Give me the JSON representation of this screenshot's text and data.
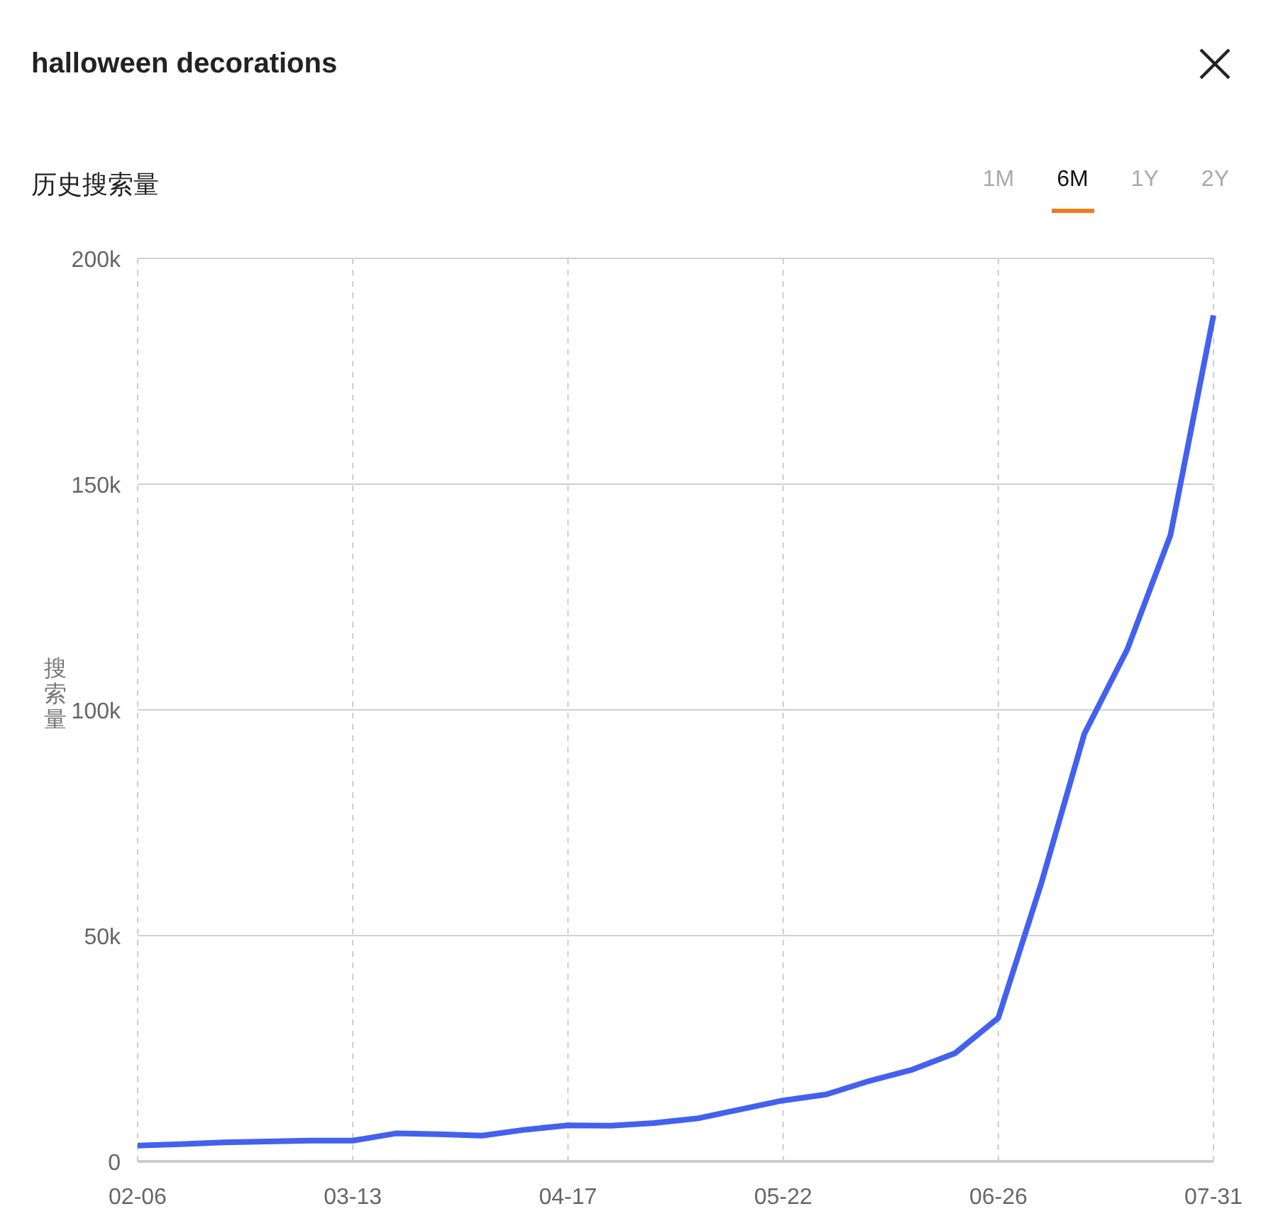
{
  "title": "halloween decorations",
  "section_title": "历史搜索量",
  "tabs": [
    {
      "label": "1M",
      "selected": false
    },
    {
      "label": "6M",
      "selected": true
    },
    {
      "label": "1Y",
      "selected": false
    },
    {
      "label": "2Y",
      "selected": false
    }
  ],
  "chart_data": {
    "type": "line",
    "ylabel": "搜索量",
    "categories": [
      "02-06",
      null,
      null,
      null,
      null,
      "03-13",
      null,
      null,
      null,
      null,
      "04-17",
      null,
      null,
      null,
      null,
      "05-22",
      null,
      null,
      null,
      null,
      "06-26",
      null,
      null,
      null,
      null,
      "07-31"
    ],
    "series": [
      {
        "color": "#4361ee",
        "values": [
          3500,
          3800,
          4200,
          4400,
          4600,
          4600,
          6200,
          6000,
          5700,
          7000,
          8000,
          7900,
          8500,
          9500,
          11500,
          13500,
          14800,
          17800,
          20300,
          24000,
          31800,
          61600,
          94700,
          113500,
          138700,
          187400
        ]
      }
    ],
    "ylim": [
      0,
      200000
    ],
    "grid": true,
    "yticks": [
      {
        "value": 0,
        "label": "0"
      },
      {
        "value": 50000,
        "label": "50k"
      },
      {
        "value": 100000,
        "label": "100k"
      },
      {
        "value": 150000,
        "label": "150k"
      },
      {
        "value": 200000,
        "label": "200k"
      }
    ]
  }
}
